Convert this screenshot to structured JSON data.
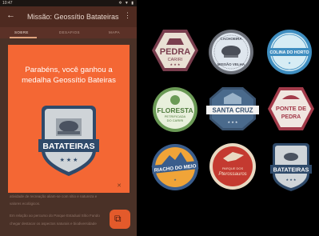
{
  "status_bar": {
    "time": "10:47",
    "icons": "✲ ▼ ▮"
  },
  "app_bar": {
    "back_icon": "arrow-back-icon",
    "title": "Missão: Geossítio Batateiras",
    "menu_icon": "overflow-menu-icon"
  },
  "tabs": [
    {
      "label": "SOBRE",
      "active": true
    },
    {
      "label": "DESAFIOS",
      "active": false
    },
    {
      "label": "MAPA",
      "active": false
    }
  ],
  "dialog": {
    "message": "Parabéns, você ganhou a medalha Geossítio Bateiras",
    "badge_label": "BATATEIRAS",
    "close_icon": "close-icon",
    "color": "#f46734"
  },
  "background_text": [
    "atividade de recreação aliam-se com sítio e natureza e",
    "valores ecológicos.",
    "Em relação ao percurso do Parque Estadual Sítio Fundo",
    "chegar destacar os aspectos naturais e biodiversidade"
  ],
  "fab": {
    "icon": "share-icon"
  },
  "badges": [
    {
      "id": "pedra-cariri",
      "lines": [
        "PEDRA",
        "CARIRI"
      ],
      "shape": "hexagon",
      "fill": "#e9e0d4",
      "ring": "#7a3e4e"
    },
    {
      "id": "cachoeira-missao-velha",
      "lines": [
        "CACHOEIRA",
        "MISSÃO VELHA"
      ],
      "shape": "circle",
      "fill": "#dfe6ee",
      "ring": "#6b6f78"
    },
    {
      "id": "colina-do-horto",
      "lines": [
        "COLINA DO HORTO"
      ],
      "shape": "circle",
      "fill": "#d6ecf4",
      "ring": "#3f8ec0"
    },
    {
      "id": "floresta-petrificada",
      "lines": [
        "FLORESTA",
        "PETRIFICADA",
        "DO CARIRI"
      ],
      "shape": "circle",
      "fill": "#e8f0dc",
      "ring": "#6b9a56"
    },
    {
      "id": "santa-cruz",
      "lines": [
        "SANTA CRUZ"
      ],
      "shape": "octagon",
      "fill": "#4a6a8c",
      "ring": "#3a5370"
    },
    {
      "id": "ponte-de-pedra",
      "lines": [
        "PONTE DE",
        "PEDRA"
      ],
      "shape": "hexagon",
      "fill": "#f0e6e0",
      "ring": "#a33b4a"
    },
    {
      "id": "riacho-do-meio",
      "lines": [
        "RIACHO DO MEIO"
      ],
      "shape": "circle",
      "fill": "#f0a438",
      "ring": "#3a5d8c"
    },
    {
      "id": "parque-dos-pterossauros",
      "lines": [
        "PARQUE DOS",
        "Pterossauros"
      ],
      "shape": "circle",
      "fill": "#c43a30",
      "ring": "#e9d9c2"
    },
    {
      "id": "batateiras",
      "lines": [
        "BATATEIRAS"
      ],
      "shape": "shield",
      "fill": "#cfd4d8",
      "ring": "#2f4a6a"
    }
  ]
}
